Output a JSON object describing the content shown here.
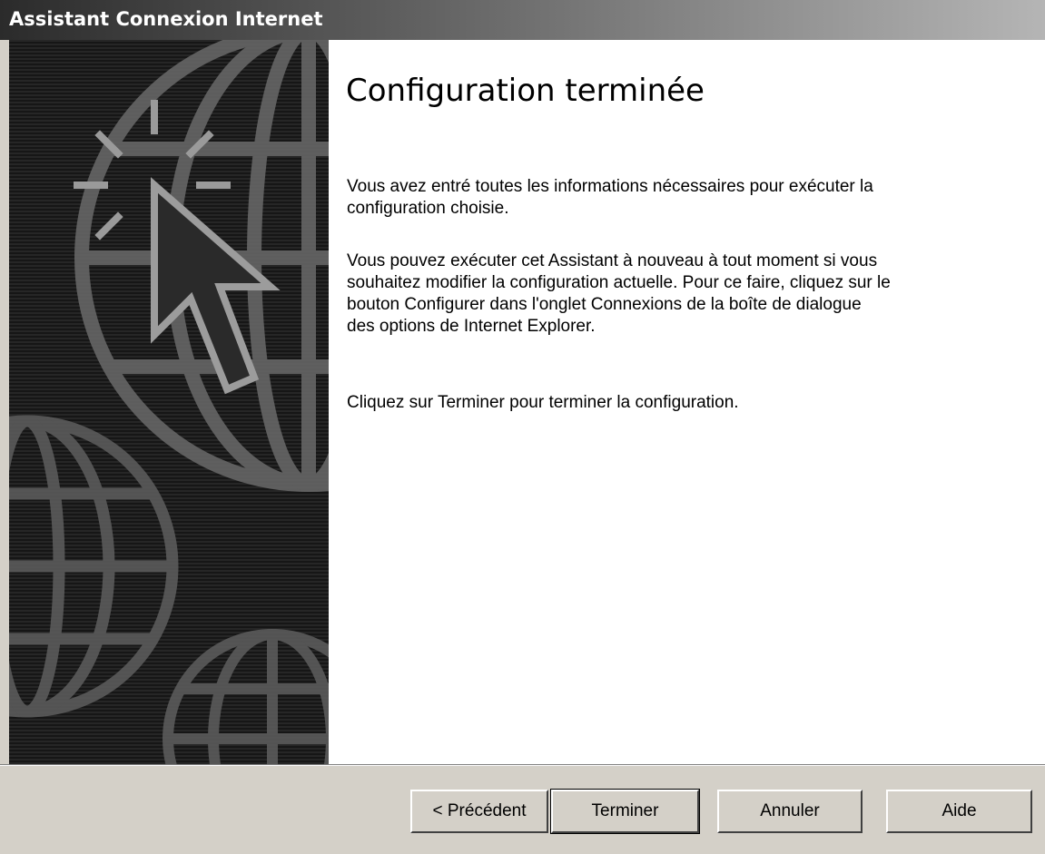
{
  "window": {
    "title": "Assistant Connexion Internet"
  },
  "page": {
    "heading": "Configuration terminée",
    "paragraphs": [
      "Vous avez entré toutes les informations nécessaires pour exécuter la configuration choisie.",
      "Vous pouvez exécuter cet Assistant à nouveau à tout moment si vous souhaitez modifier la configuration actuelle. Pour ce faire, cliquez sur le bouton Configurer dans l'onglet Connexions de la boîte de dialogue des options de Internet Explorer.",
      "Cliquez sur Terminer pour terminer la configuration."
    ]
  },
  "banner": {
    "icons": [
      "globe-icon",
      "cursor-arrow-icon",
      "sparkle-icon"
    ]
  },
  "buttons": {
    "previous": "< Précédent",
    "finish": "Terminer",
    "cancel": "Annuler",
    "help": "Aide"
  },
  "colors": {
    "dialog_face": "#d4d0c8",
    "banner_background": "#1e1e1e",
    "content_background": "#ffffff"
  }
}
